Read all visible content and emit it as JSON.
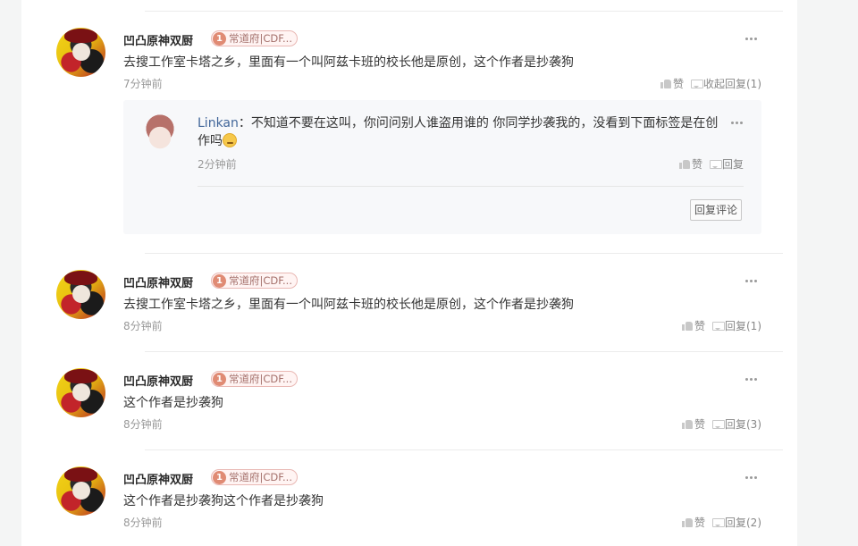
{
  "comments": [
    {
      "user": "凹凸原神双厨",
      "badge_level": "1",
      "badge_text": "常道府|CDF...",
      "text": "去搜工作室卡塔之乡，里面有一个叫阿兹卡班的校长他是原创，这个作者是抄袭狗",
      "time": "7分钟前",
      "like_label": "赞",
      "reply_label": "收起回复(1)",
      "replies": [
        {
          "user": "Linkan",
          "text": "：不知道不要在这叫，你问问别人谁盗用谁的 你同学抄袭我的，没看到下面标签是在创作吗",
          "emoji": "sweat-emoji",
          "time": "2分钟前",
          "like_label": "赞",
          "reply_label": "回复"
        }
      ],
      "reply_comment_label": "回复评论"
    },
    {
      "user": "凹凸原神双厨",
      "badge_level": "1",
      "badge_text": "常道府|CDF...",
      "text": "去搜工作室卡塔之乡，里面有一个叫阿兹卡班的校长他是原创，这个作者是抄袭狗",
      "time": "8分钟前",
      "like_label": "赞",
      "reply_label": "回复(1)"
    },
    {
      "user": "凹凸原神双厨",
      "badge_level": "1",
      "badge_text": "常道府|CDF...",
      "text": "这个作者是抄袭狗",
      "time": "8分钟前",
      "like_label": "赞",
      "reply_label": "回复(3)"
    },
    {
      "user": "凹凸原神双厨",
      "badge_level": "1",
      "badge_text": "常道府|CDF...",
      "text": "这个作者是抄袭狗这个作者是抄袭狗",
      "time": "8分钟前",
      "like_label": "赞",
      "reply_label": "回复(2)"
    }
  ],
  "colors": {
    "page_bg": "#f4f5f5",
    "username_link": "#406599",
    "badge_bg": "#fff4f3",
    "badge_border": "#e9b8b4",
    "muted_text": "#999999"
  }
}
